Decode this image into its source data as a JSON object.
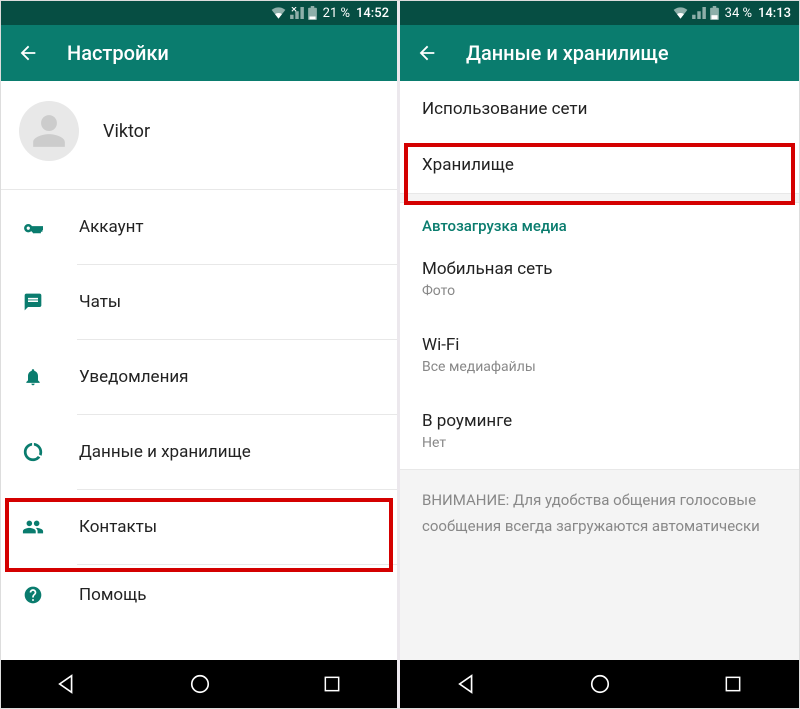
{
  "left": {
    "status": {
      "battery": "21 %",
      "time": "14:52"
    },
    "toolbar_title": "Настройки",
    "profile_name": "Viktor",
    "menu": {
      "account": "Аккаунт",
      "chats": "Чаты",
      "notifications": "Уведомления",
      "data": "Данные и хранилище",
      "contacts": "Контакты",
      "help": "Помощь"
    }
  },
  "right": {
    "status": {
      "battery": "34 %",
      "time": "14:13"
    },
    "toolbar_title": "Данные и хранилище",
    "items": {
      "net_usage": "Использование сети",
      "storage": "Хранилище",
      "section_autodownload": "Автозагрузка медиа",
      "mobile": {
        "title": "Мобильная сеть",
        "sub": "Фото"
      },
      "wifi": {
        "title": "Wi-Fi",
        "sub": "Все медиафайлы"
      },
      "roaming": {
        "title": "В роуминге",
        "sub": "Нет"
      },
      "note": "ВНИМАНИЕ: Для удобства общения голосовые сообщения всегда загружаются автоматически"
    }
  }
}
